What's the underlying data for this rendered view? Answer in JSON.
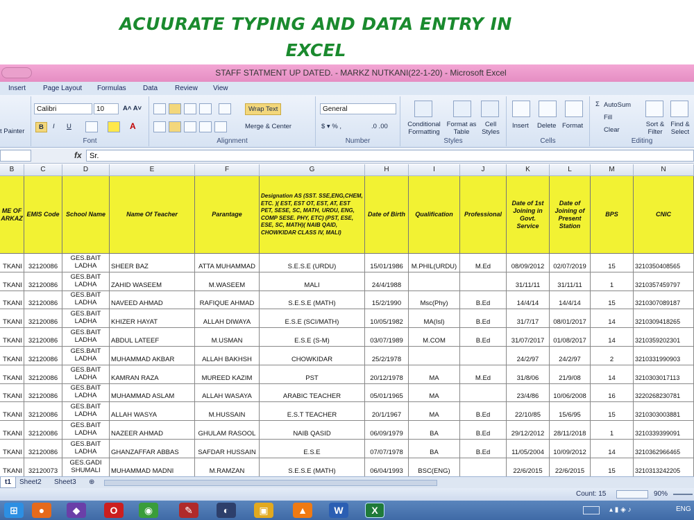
{
  "banner": {
    "line1": "ACUURATE  TYPING AND DATA ENTRY  IN",
    "line2": "EXCEL"
  },
  "window": {
    "title": "STAFF STATMENT UP DATED. - MARKZ NUTKANI(22-1-20) - Microsoft Excel"
  },
  "menu": [
    "Insert",
    "Page Layout",
    "Formulas",
    "Data",
    "Review",
    "View"
  ],
  "ribbon": {
    "clipboard": {
      "format_painter": "t Painter"
    },
    "font": {
      "name": "Calibri",
      "size": "10",
      "label": "Font"
    },
    "alignment": {
      "wrap_text": "Wrap Text",
      "merge_center": "Merge & Center",
      "label": "Alignment"
    },
    "number": {
      "format": "General",
      "label": "Number"
    },
    "styles": {
      "conditional": "Conditional Formatting",
      "format_table": "Format as Table",
      "cell_styles": "Cell Styles",
      "label": "Styles"
    },
    "cells": {
      "insert": "Insert",
      "delete": "Delete",
      "format": "Format",
      "label": "Cells"
    },
    "editing": {
      "autosum": "AutoSum",
      "fill": "Fill",
      "clear": "Clear",
      "sort": "Sort & Filter",
      "find": "Find & Select",
      "label": "Editing"
    }
  },
  "formula_bar": {
    "fx": "fx",
    "content": "Sr."
  },
  "column_letters": [
    "B",
    "C",
    "D",
    "E",
    "F",
    "G",
    "H",
    "I",
    "J",
    "K",
    "L",
    "M",
    "N"
  ],
  "headers": [
    "ME OF ARKAZ",
    "EMIS Code",
    "School Name",
    "Name Of Teacher",
    "Parantage",
    "Designation AS (SST. SSE,ENG,CHEM, ETC. )( EST, EST OT, EST, AT, EST PET, SESE, SC, MATH, URDU, ENG, COMP SESE. PHY, ETC) (PST, ESE, ESE, SC, MATH)( NAIB QAID, CHOWKIDAR CLASS IV, MALI)",
    "Date of Birth",
    "Qualification",
    "Professional",
    "Date of 1st Joining in Govt. Service",
    "Date of Joining of Present Station",
    "BPS",
    "CNIC"
  ],
  "rows": [
    [
      "TKANI",
      "32120086",
      "GES.BAIT LADHA",
      "SHEER BAZ",
      "ATTA MUHAMMAD",
      "S.E.S.E (URDU)",
      "15/01/1986",
      "M.PHIL(URDU)",
      "M.Ed",
      "08/09/2012",
      "02/07/2019",
      "15",
      "3210350408565"
    ],
    [
      "TKANI",
      "32120086",
      "GES.BAIT LADHA",
      "ZAHID WASEEM",
      "M.WASEEM",
      "MALI",
      "24/4/1988",
      "",
      "",
      "31/11/11",
      "31/11/11",
      "1",
      "3210357459797"
    ],
    [
      "TKANI",
      "32120086",
      "GES.BAIT LADHA",
      "NAVEED AHMAD",
      "RAFIQUE AHMAD",
      "S.E.S.E (MATH)",
      "15/2/1990",
      "Msc(Phy)",
      "B.Ed",
      "14/4/14",
      "14/4/14",
      "15",
      "3210307089187"
    ],
    [
      "TKANI",
      "32120086",
      "GES.BAIT LADHA",
      "KHIZER HAYAT",
      "ALLAH DIWAYA",
      "E.S.E (SCI/MATH)",
      "10/05/1982",
      "MA(Isl)",
      "B.Ed",
      "31/7/17",
      "08/01/2017",
      "14",
      "3210309418265"
    ],
    [
      "TKANI",
      "32120086",
      "GES.BAIT LADHA",
      "ABDUL LATEEF",
      "M.USMAN",
      "E.S.E (S-M)",
      "03/07/1989",
      "M.COM",
      "B.Ed",
      "31/07/2017",
      "01/08/2017",
      "14",
      "3210359202301"
    ],
    [
      "TKANI",
      "32120086",
      "GES.BAIT LADHA",
      "MUHAMMAD AKBAR",
      "ALLAH BAKHSH",
      "CHOWKIDAR",
      "25/2/1978",
      "",
      "",
      "24/2/97",
      "24/2/97",
      "2",
      "3210331990903"
    ],
    [
      "TKANI",
      "32120086",
      "GES.BAIT LADHA",
      "KAMRAN RAZA",
      "MUREED KAZIM",
      "PST",
      "20/12/1978",
      "MA",
      "M.Ed",
      "31/8/06",
      "21/9/08",
      "14",
      "3210303017113"
    ],
    [
      "TKANI",
      "32120086",
      "GES.BAIT LADHA",
      "MUHAMMAD ASLAM",
      "ALLAH WASAYA",
      "ARABIC TEACHER",
      "05/01/1965",
      "MA",
      "",
      "23/4/86",
      "10/06/2008",
      "16",
      "3220268230781"
    ],
    [
      "TKANI",
      "32120086",
      "GES.BAIT LADHA",
      "ALLAH WASYA",
      "M.HUSSAIN",
      "E.S.T TEACHER",
      "20/1/1967",
      "MA",
      "B.Ed",
      "22/10/85",
      "15/6/95",
      "15",
      "3210303003881"
    ],
    [
      "TKANI",
      "32120086",
      "GES.BAIT LADHA",
      "NAZEER AHMAD",
      "GHULAM RASOOL",
      "NAIB QASID",
      "06/09/1979",
      "BA",
      "B.Ed",
      "29/12/2012",
      "28/11/2018",
      "1",
      "3210339399091"
    ],
    [
      "TKANI",
      "32120086",
      "GES.BAIT LADHA",
      "GHANZAFFAR ABBAS",
      "SAFDAR HUSSAIN",
      "E.S.E",
      "07/07/1978",
      "BA",
      "B.Ed",
      "11/05/2004",
      "10/09/2012",
      "14",
      "3210362966465"
    ],
    [
      "TKANI",
      "32120073",
      "GES.GADI SHUMALI",
      "MUHAMMAD MADNI",
      "M.RAMZAN",
      "S.E.S.E (MATH)",
      "06/04/1993",
      "BSC(ENG)",
      "",
      "22/6/2015",
      "22/6/2015",
      "15",
      "3210313242205"
    ]
  ],
  "tabs": [
    "t1",
    "Sheet2",
    "Sheet3"
  ],
  "status": {
    "count": "Count: 15",
    "zoom": "90%"
  },
  "taskbar": {
    "lang": "ENG"
  }
}
